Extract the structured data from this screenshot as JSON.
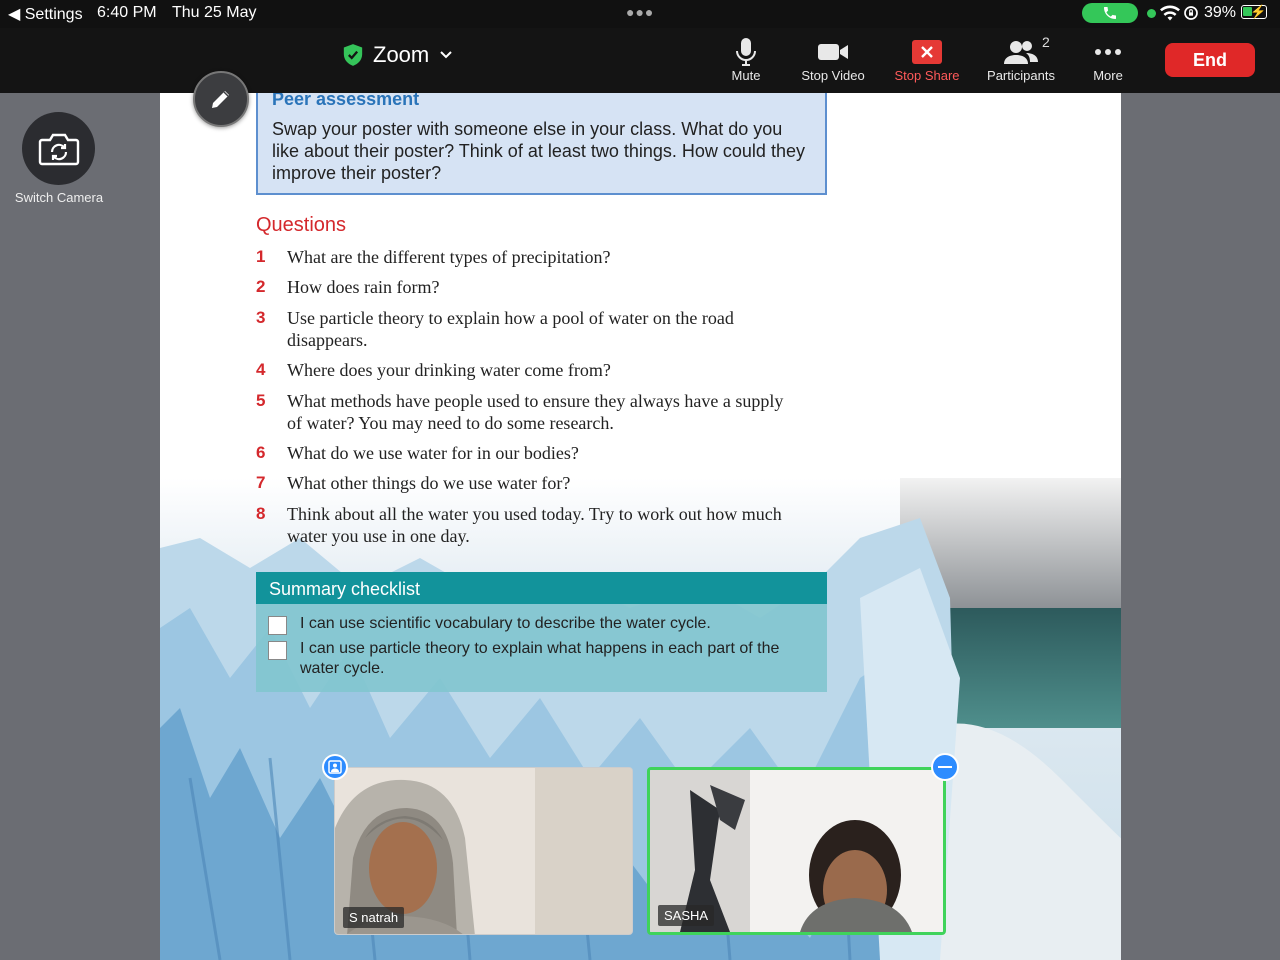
{
  "status_bar": {
    "back_label": "◀ Settings",
    "time": "6:40 PM",
    "date": "Thu 25 May",
    "battery": "39%"
  },
  "toolbar": {
    "title": "Zoom",
    "mute": "Mute",
    "stop_video": "Stop Video",
    "stop_share": "Stop Share",
    "participants": "Participants",
    "participants_count": "2",
    "more": "More",
    "end": "End"
  },
  "side": {
    "switch_camera": "Switch Camera"
  },
  "document": {
    "peer_title": "Peer assessment",
    "peer_text": "Swap your poster with someone else in your class. What do you like about their poster? Think of at least two things. How could they improve their poster?",
    "questions_title": "Questions",
    "questions": [
      {
        "n": "1",
        "text": "What are the different types of precipitation?"
      },
      {
        "n": "2",
        "text": "How does rain form?"
      },
      {
        "n": "3",
        "text": "Use particle theory to explain how a pool of water on the road disappears."
      },
      {
        "n": "4",
        "text": "Where does your drinking water come from?"
      },
      {
        "n": "5",
        "text": "What methods have people used to ensure they always have a supply of water? You may need to do some research."
      },
      {
        "n": "6",
        "text": "What do we use water for in our bodies?"
      },
      {
        "n": "7",
        "text": "What other things do we use water for?"
      },
      {
        "n": "8",
        "text": "Think about all the water you used today. Try to work out how much water you use in one day."
      }
    ],
    "checklist_title": "Summary checklist",
    "checklist": [
      "I can use scientific vocabulary to describe the water cycle.",
      "I can use particle theory to explain what happens in each part of the water cycle."
    ]
  },
  "videos": [
    {
      "name": "S natrah"
    },
    {
      "name": "SASHA"
    }
  ],
  "colors": {
    "accent_red": "#d4282c",
    "end_button": "#e02828",
    "active_speaker": "#3fd35b",
    "zoom_blue": "#2d8cff"
  }
}
